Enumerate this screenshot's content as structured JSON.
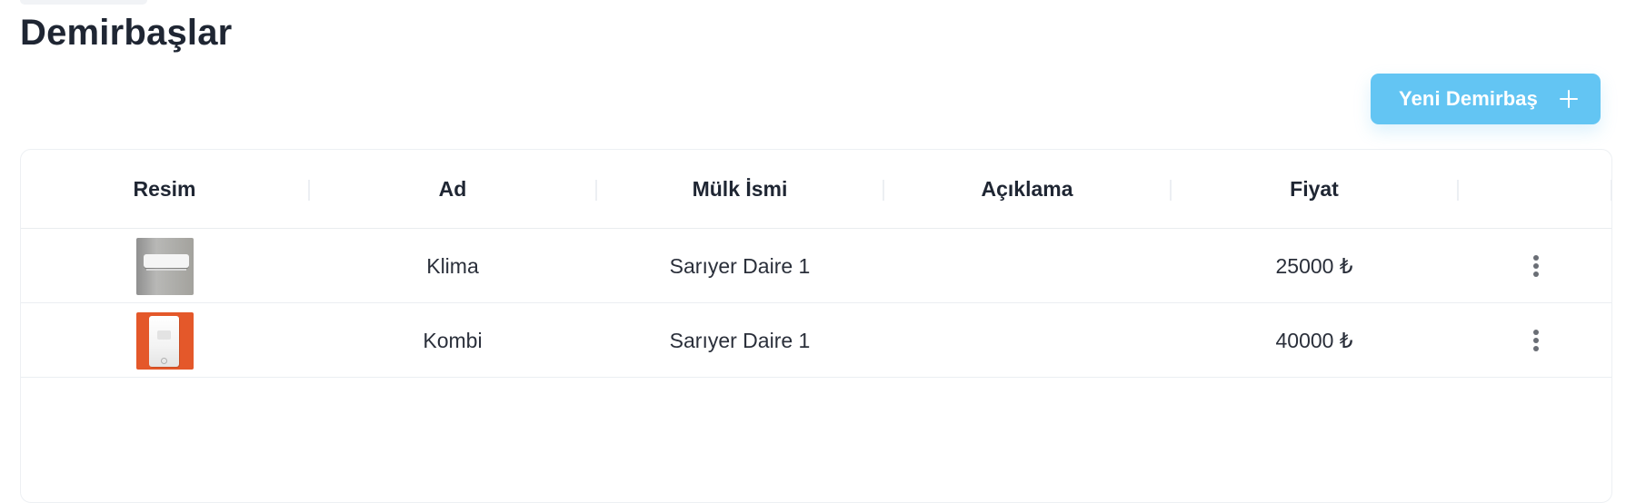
{
  "page": {
    "title": "Demirbaşlar"
  },
  "actions": {
    "new_button_label": "Yeni Demirbaş",
    "new_button_icon": "plus-icon"
  },
  "table": {
    "headers": [
      "Resim",
      "Ad",
      "Mülk İsmi",
      "Açıklama",
      "Fiyat",
      ""
    ],
    "rows": [
      {
        "image_icon": "air-conditioner-thumbnail",
        "name": "Klima",
        "property": "Sarıyer Daire 1",
        "description": "",
        "price": "25000 ₺",
        "menu_icon": "more-vertical-icon"
      },
      {
        "image_icon": "combi-boiler-thumbnail",
        "name": "Kombi",
        "property": "Sarıyer Daire 1",
        "description": "",
        "price": "40000 ₺",
        "menu_icon": "more-vertical-icon"
      }
    ]
  },
  "colors": {
    "accent": "#63c5f3",
    "text": "#1f2633"
  }
}
